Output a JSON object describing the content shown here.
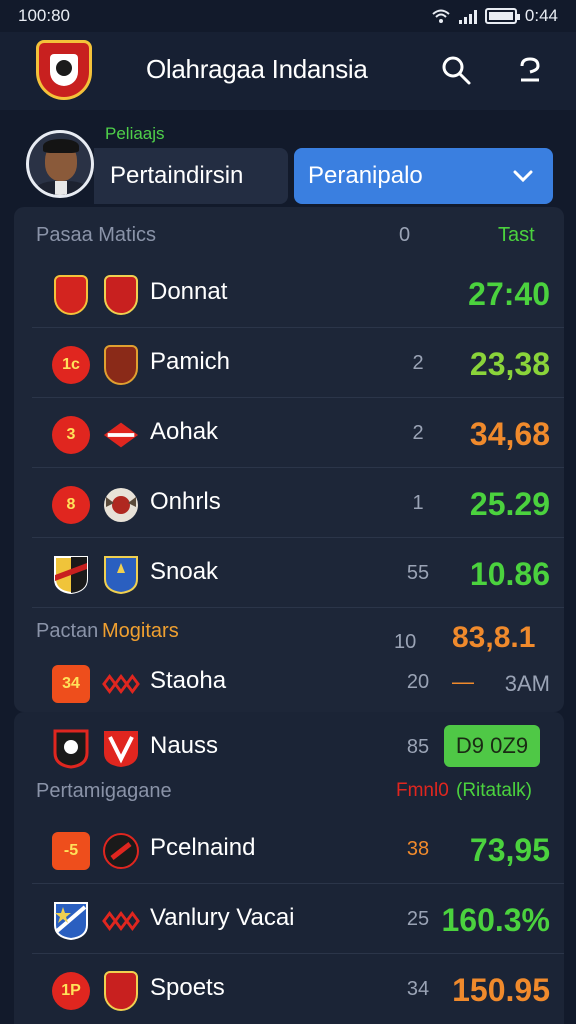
{
  "status_bar": {
    "time": "100:80",
    "clock": "0:44"
  },
  "app": {
    "title": "Olahragaa Indansia"
  },
  "selector": {
    "label": "Peliaajs",
    "segment": "Pertaindirsin",
    "dropdown_value": "Peranipalo"
  },
  "section1": {
    "title": "Pasaa Matics",
    "col_count": "0",
    "col_time": "Tast",
    "rows": [
      {
        "name": "Donnat",
        "count": "",
        "score": "27:40"
      },
      {
        "name": "Pamich",
        "count": "2",
        "score": "23,38",
        "badge1": "1c"
      },
      {
        "name": "Aohak",
        "count": "2",
        "score": "34,68",
        "badge1": "3"
      },
      {
        "name": "Onhrls",
        "count": "1",
        "score": "25.29",
        "badge1": "8"
      },
      {
        "name": "Snoak",
        "count": "55",
        "score": "10.86"
      }
    ]
  },
  "section2": {
    "title_prefix": "Pactan",
    "title_highlight": "Mogitars",
    "col_count": "10",
    "col_value": "83,8.1",
    "rows": [
      {
        "name": "Staoha",
        "count": "20",
        "dash": "—",
        "time": "3AM",
        "badge1": "34"
      }
    ]
  },
  "section3": {
    "featured": {
      "name": "Nauss",
      "count": "85",
      "pill": "D9 0Z9"
    },
    "title": "Pertamigagane",
    "legend_red": "Fmnl0",
    "legend_green": "(Ritatalk)",
    "rows": [
      {
        "name": "Pcelnaind",
        "count": "38",
        "score": "73,95",
        "badge1": "-5"
      },
      {
        "name": "Vanlury Vacai",
        "count": "25",
        "score": "160.3%"
      },
      {
        "name": "Spoets",
        "count": "34",
        "score": "150.95",
        "badge1": "1P"
      }
    ]
  },
  "colors": {
    "accent_blue": "#3a7fe0",
    "score_green": "#4bd23e",
    "score_orange": "#f08a2c",
    "badge_red": "#e0261f",
    "background": "#121a2b"
  }
}
